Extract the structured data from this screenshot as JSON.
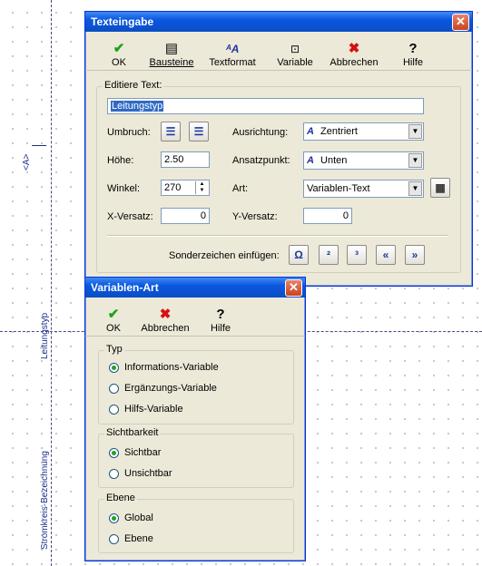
{
  "canvas": {
    "label_top": "<A>",
    "label_mid": "Leitungstyp",
    "label_bottom": "Stromkreis-Bezeichnung"
  },
  "texteingabe": {
    "title": "Texteingabe",
    "toolbar": [
      {
        "label": "OK",
        "icon": "checkmark-icon"
      },
      {
        "label": "Bausteine",
        "icon": "blocks-icon"
      },
      {
        "label": "Textformat",
        "icon": "text-format-icon"
      },
      {
        "label": "Variable",
        "icon": "variable-icon"
      },
      {
        "label": "Abbrechen",
        "icon": "cancel-x-icon"
      },
      {
        "label": "Hilfe",
        "icon": "help-icon"
      }
    ],
    "edit_group_label": "Editiere Text:",
    "edit_text_value": "Leitungstyp",
    "umbruch_label": "Umbruch:",
    "ausrichtung_label": "Ausrichtung:",
    "ausrichtung_value": "Zentriert",
    "hoehe_label": "Höhe:",
    "hoehe_value": "2.50",
    "ansatzpunkt_label": "Ansatzpunkt:",
    "ansatzpunkt_value": "Unten",
    "winkel_label": "Winkel:",
    "winkel_value": "270",
    "art_label": "Art:",
    "art_value": "Variablen-Text",
    "x_versatz_label": "X-Versatz:",
    "x_versatz_value": "0",
    "y_versatz_label": "Y-Versatz:",
    "y_versatz_value": "0",
    "sonderzeichen_label": "Sonderzeichen einfügen:",
    "sonderzeichen": [
      "Ω",
      "²",
      "³",
      "«",
      "»"
    ]
  },
  "variablen_art": {
    "title": "Variablen-Art",
    "toolbar": [
      {
        "label": "OK",
        "icon": "checkmark-icon"
      },
      {
        "label": "Abbrechen",
        "icon": "cancel-x-icon"
      },
      {
        "label": "Hilfe",
        "icon": "help-icon"
      }
    ],
    "typ_label": "Typ",
    "typ_options": [
      {
        "label": "Informations-Variable",
        "selected": true
      },
      {
        "label": "Ergänzungs-Variable",
        "selected": false
      },
      {
        "label": "Hilfs-Variable",
        "selected": false
      }
    ],
    "sichtbarkeit_label": "Sichtbarkeit",
    "sichtbarkeit_options": [
      {
        "label": "Sichtbar",
        "selected": true
      },
      {
        "label": "Unsichtbar",
        "selected": false
      }
    ],
    "ebene_label": "Ebene",
    "ebene_options": [
      {
        "label": "Global",
        "selected": true
      },
      {
        "label": "Ebene",
        "selected": false
      }
    ]
  }
}
